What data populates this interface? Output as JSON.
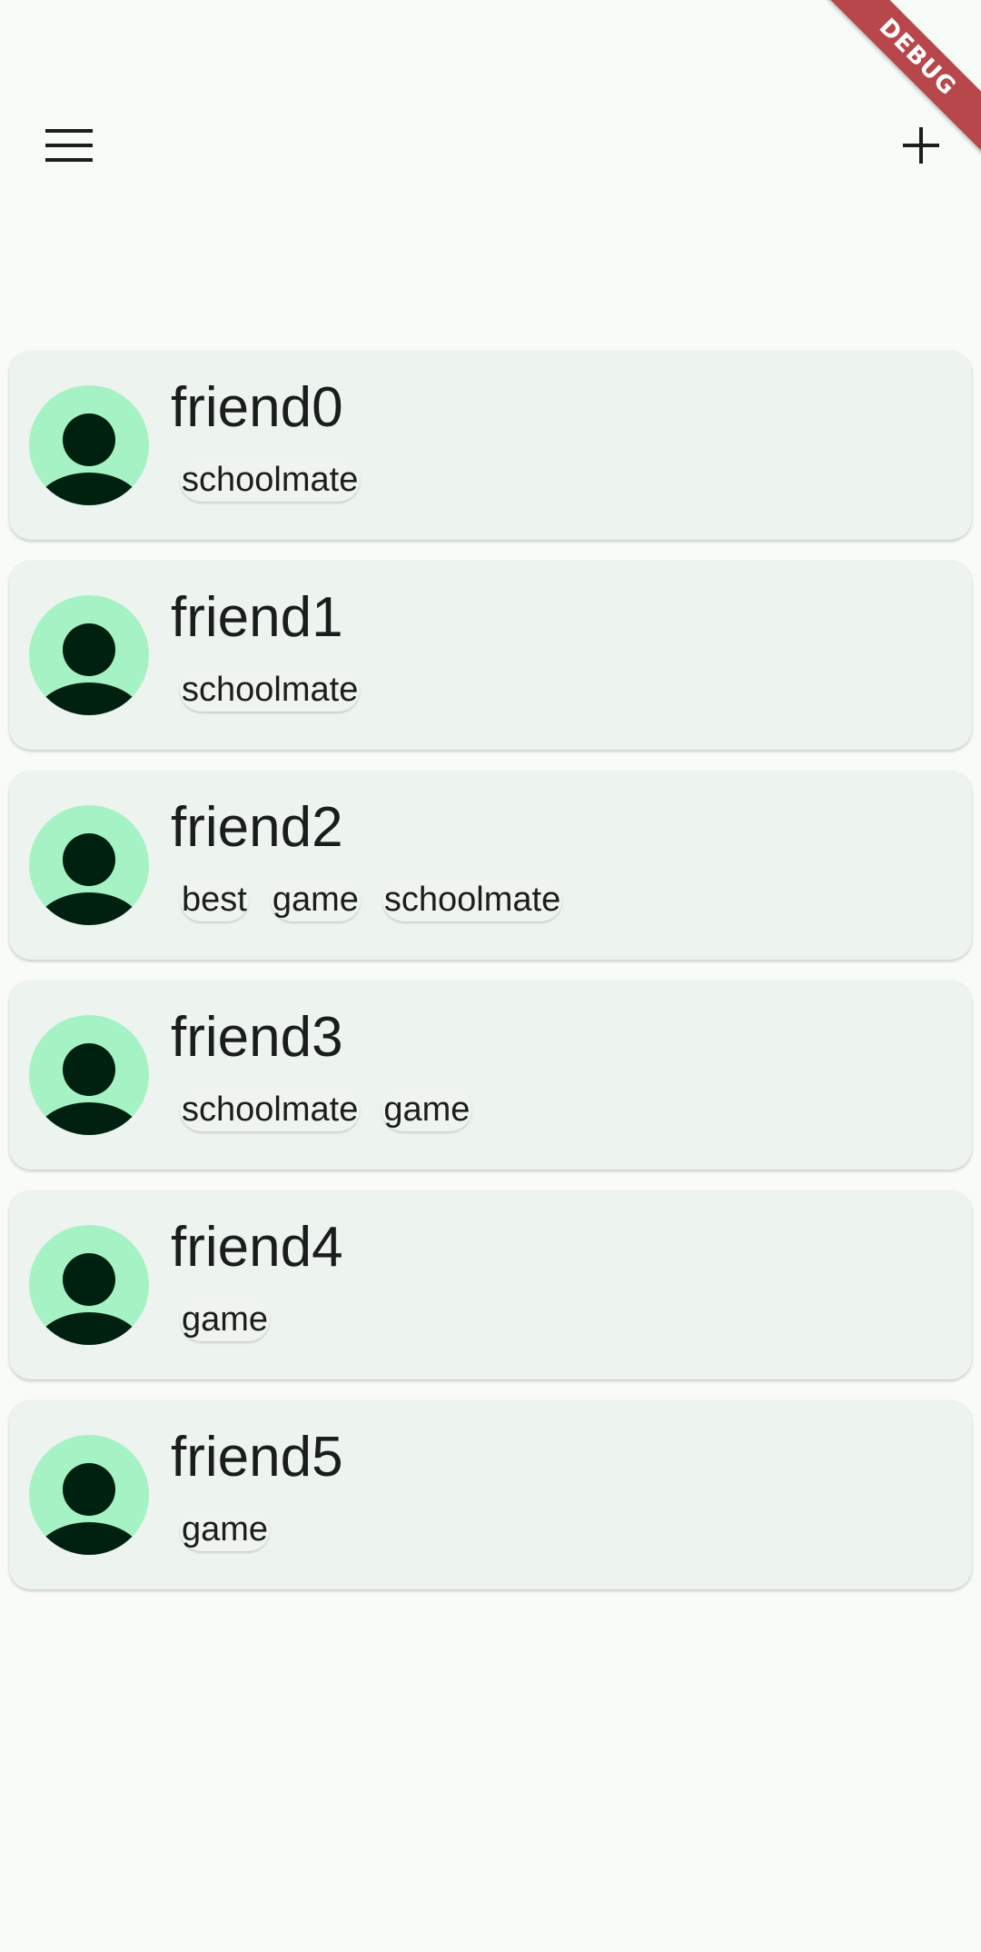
{
  "app_bar": {
    "menu_icon": "menu-icon",
    "add_icon": "add-icon"
  },
  "debug_banner": {
    "label": "DEBUG",
    "color": "#b7474a"
  },
  "colors": {
    "avatar_background": "#a5f2c4",
    "avatar_foreground": "#00210f",
    "card_background": "#edf3ee",
    "page_background": "#f8fbf6"
  },
  "friends": [
    {
      "name": "friend0",
      "tags": [
        "schoolmate"
      ]
    },
    {
      "name": "friend1",
      "tags": [
        "schoolmate"
      ]
    },
    {
      "name": "friend2",
      "tags": [
        "best",
        "game",
        "schoolmate"
      ]
    },
    {
      "name": "friend3",
      "tags": [
        "schoolmate",
        "game"
      ]
    },
    {
      "name": "friend4",
      "tags": [
        "game"
      ]
    },
    {
      "name": "friend5",
      "tags": [
        "game"
      ]
    }
  ]
}
